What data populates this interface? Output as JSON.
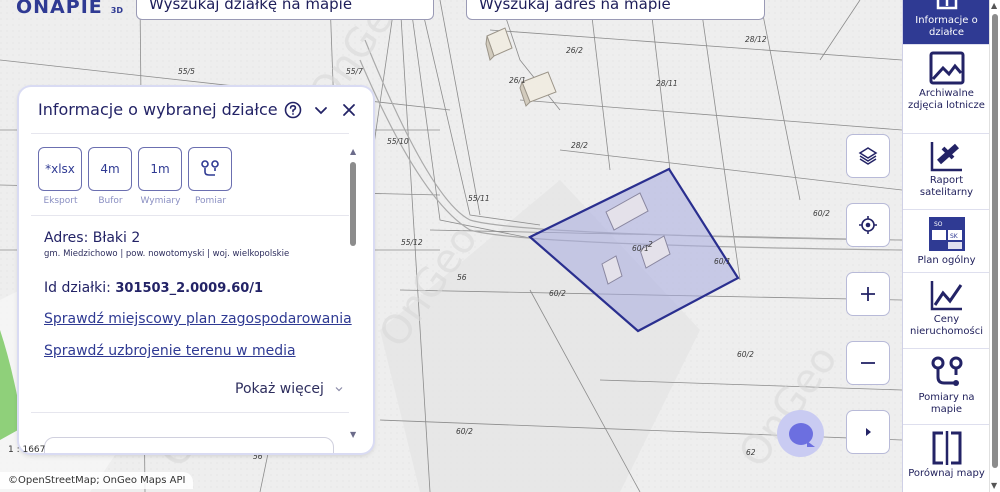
{
  "app": {
    "logo_text": "NAPIE",
    "logo_badge": "3D",
    "logo_prefix": "O"
  },
  "search": {
    "parcel_placeholder": "Wyszukaj działkę na mapie",
    "address_placeholder": "Wyszukaj adres na mapie"
  },
  "panel": {
    "title": "Informacje o wybranej działce",
    "tools": [
      {
        "icon_text": "*xlsx",
        "label": "Eksport"
      },
      {
        "icon_text": "4m",
        "label": "Bufor"
      },
      {
        "icon_text": "1m",
        "label": "Wymiary"
      },
      {
        "icon_text": "",
        "label": "Pomiar"
      }
    ],
    "address": "Adres: Błaki 2",
    "admin": "gm. Miedzichowo | pow. nowotomyski | woj. wielkopolskie",
    "id_label": "Id działki:",
    "id_value": "301503_2.0009.60/1",
    "link_plan": "Sprawdź miejscowy plan zagospodarowania",
    "link_media": "Sprawdź uzbrojenie terenu w media",
    "show_more": "Pokaż więcej"
  },
  "map": {
    "parcel_labels": [
      "26/2",
      "28/12",
      "55/5",
      "55/7",
      "26/1",
      "28/11",
      "55/10",
      "28/2",
      "55/11",
      "60/2",
      "55/12",
      "60/1",
      "56",
      "60/2",
      "60/2",
      "60/2",
      "62",
      "56",
      "60/1",
      "2"
    ],
    "watermark": "OnGeo",
    "scale": "1 : 1667",
    "attribution": "©OpenStreetMap; OnGeo Maps API",
    "highlight_color": "#2a2f8f"
  },
  "sidebar": {
    "items": [
      {
        "label": "Informacje o działce",
        "icon": "map-pin-icon",
        "active": true
      },
      {
        "label": "Archiwalne zdjęcia lotnicze",
        "icon": "image-icon",
        "active": false
      },
      {
        "label": "Raport satelitarny",
        "icon": "satellite-icon",
        "active": false
      },
      {
        "label": "Plan ogólny",
        "icon": "plan-map-icon",
        "active": false
      },
      {
        "label": "Ceny nieruchomości",
        "icon": "price-chart-icon",
        "active": false
      },
      {
        "label": "Pomiary na mapie",
        "icon": "route-measure-icon",
        "active": false
      },
      {
        "label": "Porównaj mapy",
        "icon": "compare-icon",
        "active": false
      }
    ]
  }
}
